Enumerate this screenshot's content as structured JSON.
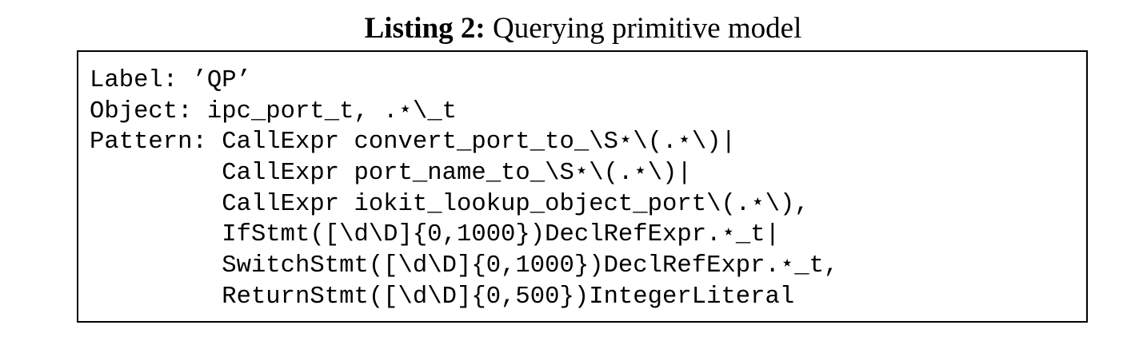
{
  "caption": {
    "label": "Listing 2:",
    "title": "Querying primitive model"
  },
  "listing": {
    "lines": [
      "Label: ’QP’",
      "Object: ipc_port_t, .⋆\\_t",
      "Pattern: CallExpr convert_port_to_\\S⋆\\(.⋆\\)|",
      "         CallExpr port_name_to_\\S⋆\\(.⋆\\)|",
      "         CallExpr iokit_lookup_object_port\\(.⋆\\),",
      "         IfStmt([\\d\\D]{0,1000})DeclRefExpr.⋆_t|",
      "         SwitchStmt([\\d\\D]{0,1000})DeclRefExpr.⋆_t,",
      "         ReturnStmt([\\d\\D]{0,500})IntegerLiteral"
    ]
  }
}
